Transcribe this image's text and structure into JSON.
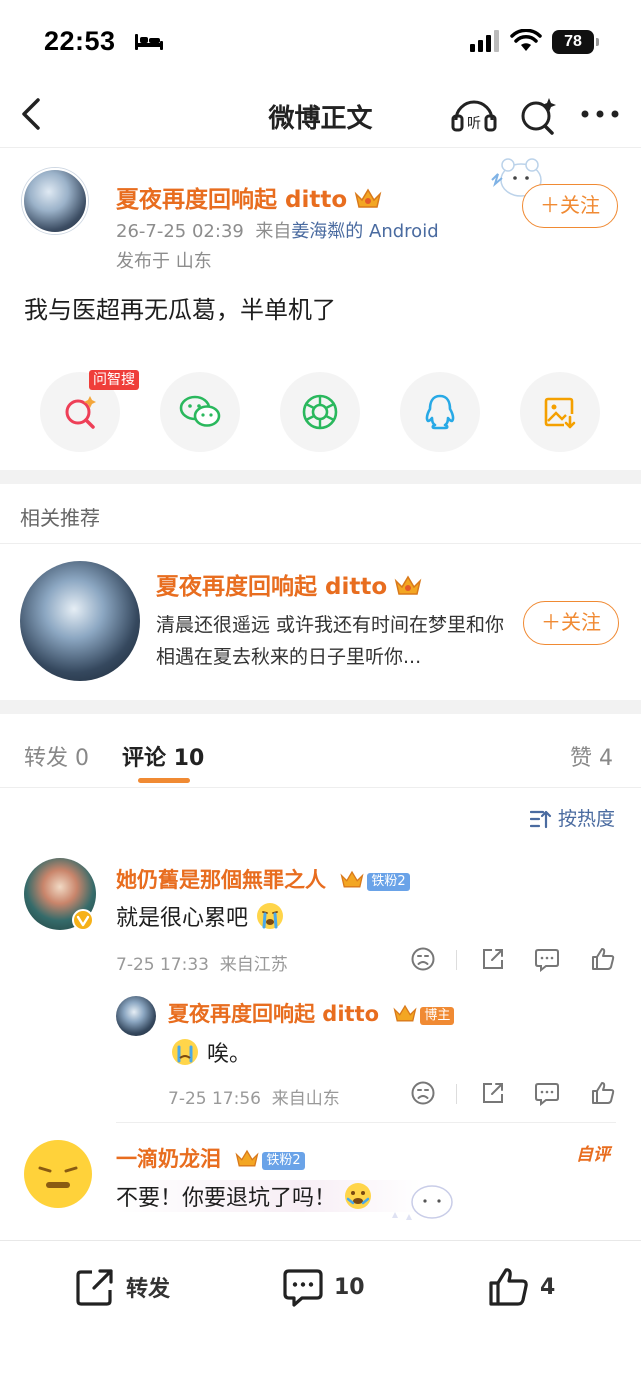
{
  "status_bar": {
    "time": "22:53",
    "battery": "78"
  },
  "nav": {
    "title": "微博正文",
    "icons": [
      "back-icon",
      "listen-icon",
      "ai-search-icon",
      "more-icon"
    ]
  },
  "post": {
    "author": "夏夜再度回响起 ditto",
    "date": "26-7-25 02:39",
    "from_prefix": "来自",
    "from_source": "姜海粼的 Android",
    "location": "发布于 山东",
    "text": "我与医超再无瓜葛，半单机了",
    "follow_label": "＋关注"
  },
  "share": {
    "ask_badge": "问智搜",
    "items": [
      "ai-search-icon",
      "wechat-icon",
      "moments-icon",
      "qq-icon",
      "save-image-icon"
    ]
  },
  "recommend": {
    "header": "相关推荐",
    "name": "夏夜再度回响起 ditto",
    "desc": "清晨还很遥远 或许我还有时间在梦里和你相遇在夏去秋来的日子里听你...",
    "follow_label": "＋关注"
  },
  "tabs": {
    "repost": "转发 0",
    "comments": "评论 10",
    "likes": "赞 4"
  },
  "sort_label": "按热度",
  "comments": [
    {
      "name": "她仍舊是那個無罪之人",
      "badge": "铁粉2",
      "text": "就是很心累吧",
      "time": "7-25 17:33",
      "from": "来自江苏"
    },
    {
      "name": "夏夜再度回响起 ditto",
      "badge": "博主",
      "text": "唉。",
      "time": "7-25 17:56",
      "from": "来自山东"
    },
    {
      "name": "一滴奶龙泪",
      "badge": "铁粉2",
      "text": "不要！你要退坑了吗！",
      "tag": "自评"
    }
  ],
  "bottom": {
    "repost": "转发",
    "comments": "10",
    "likes": "4"
  },
  "colors": {
    "accent": "#f08a33",
    "name": "#e86d1f",
    "link": "#4a6ba0"
  }
}
